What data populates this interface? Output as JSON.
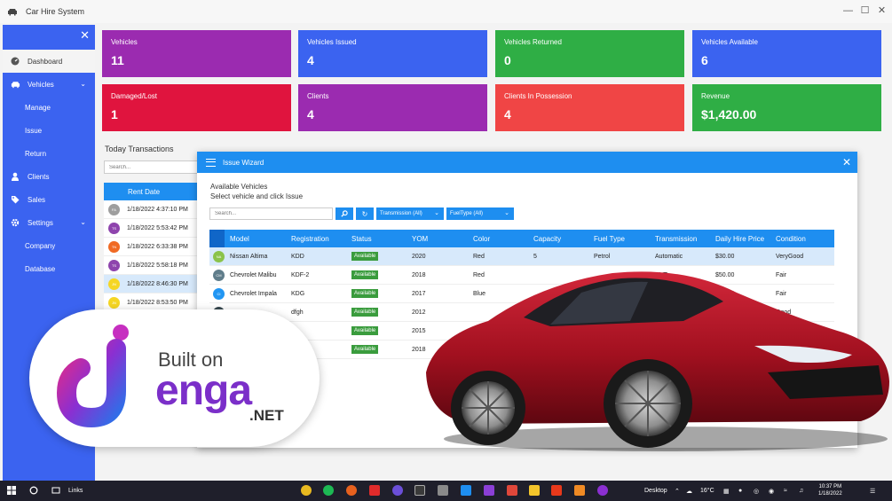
{
  "window": {
    "title": "Car Hire System"
  },
  "sidebar": {
    "items": [
      {
        "label": "Dashboard",
        "icon": "gauge-icon",
        "type": "main"
      },
      {
        "label": "Vehicles",
        "icon": "car-icon",
        "type": "main",
        "expanded": true
      },
      {
        "label": "Manage",
        "type": "sub"
      },
      {
        "label": "Issue",
        "type": "sub"
      },
      {
        "label": "Return",
        "type": "sub"
      },
      {
        "label": "Clients",
        "icon": "user-icon",
        "type": "main"
      },
      {
        "label": "Sales",
        "icon": "tag-icon",
        "type": "main"
      },
      {
        "label": "Settings",
        "icon": "gear-icon",
        "type": "main",
        "expanded": true
      },
      {
        "label": "Company",
        "type": "sub"
      },
      {
        "label": "Database",
        "type": "sub"
      }
    ]
  },
  "cards": [
    {
      "label": "Vehicles",
      "value": "11",
      "color": "#9b2bb0"
    },
    {
      "label": "Vehicles Issued",
      "value": "4",
      "color": "#3b63f0"
    },
    {
      "label": "Vehicles Returned",
      "value": "0",
      "color": "#2fae45"
    },
    {
      "label": "Vehicles Available",
      "value": "6",
      "color": "#3b63f0"
    },
    {
      "label": "Damaged/Lost",
      "value": "1",
      "color": "#e0143e"
    },
    {
      "label": "Clients",
      "value": "4",
      "color": "#9b2bb0"
    },
    {
      "label": "Clients In Possession",
      "value": "4",
      "color": "#f04545"
    },
    {
      "label": "Revenue",
      "value": "$1,420.00",
      "color": "#2fae45"
    }
  ],
  "transactions": {
    "title": "Today Transactions",
    "search_placeholder": "Search...",
    "header": "Rent Date",
    "rows": [
      {
        "initials": "FA",
        "color": "#9e9e9e",
        "date": "1/18/2022 4:37:10 PM"
      },
      {
        "initials": "TS",
        "color": "#8e44ad",
        "date": "1/18/2022 5:53:42 PM"
      },
      {
        "initials": "TN",
        "color": "#f06a24",
        "date": "1/18/2022 6:33:38 PM"
      },
      {
        "initials": "TS",
        "color": "#8e44ad",
        "date": "1/18/2022 5:58:18 PM"
      },
      {
        "initials": "JN",
        "color": "#f5d623",
        "date": "1/18/2022 8:46:30 PM",
        "selected": true
      },
      {
        "initials": "JN",
        "color": "#f5d623",
        "date": "1/18/2022 8:53:50 PM"
      }
    ]
  },
  "wizard": {
    "title": "Issue Wizard",
    "heading1": "Available Vehicles",
    "heading2": "Select vehicle and click Issue",
    "search_placeholder": "Search...",
    "transmission_filter": "Transmission (All)",
    "fueltype_filter": "FuelType (All)",
    "columns": [
      "Model",
      "Registration",
      "Status",
      "YOM",
      "Color",
      "Capacity",
      "Fuel Type",
      "Transmission",
      "Daily Hire Price",
      "Condition"
    ],
    "rows": [
      {
        "initials": "NA",
        "color": "#8bc34a",
        "model": "Nissan Altima",
        "registration": "KDD",
        "status": "Available",
        "yom": "2020",
        "color_name": "Red",
        "capacity": "5",
        "fuel": "Petrol",
        "transmission": "Automatic",
        "price": "$30.00",
        "condition": "VeryGood",
        "selected": true
      },
      {
        "initials": "CM",
        "color": "#607d8b",
        "model": "Chevrolet Malibu",
        "registration": "KDF-2",
        "status": "Available",
        "yom": "2018",
        "color_name": "Red",
        "capacity": "",
        "fuel": "",
        "transmission": "CVT",
        "price": "$50.00",
        "condition": "Fair"
      },
      {
        "initials": "CI",
        "color": "#2196f3",
        "model": "Chevrolet Impala",
        "registration": "KDG",
        "status": "Available",
        "yom": "2017",
        "color_name": "Blue",
        "capacity": "",
        "fuel": "",
        "transmission": "",
        "price": "$45.00",
        "condition": "Fair"
      },
      {
        "initials": "",
        "color": "#37474f",
        "model": "",
        "registration": "dfgh",
        "status": "Available",
        "yom": "2012",
        "color_name": "",
        "capacity": "",
        "fuel": "",
        "transmission": "",
        "price": "",
        "condition": "Good"
      },
      {
        "initials": "",
        "color": "#cccccc",
        "model": "",
        "registration": "",
        "status": "Available",
        "yom": "2015",
        "color_name": "",
        "capacity": "",
        "fuel": "",
        "transmission": "",
        "price": "",
        "condition": ""
      },
      {
        "initials": "",
        "color": "#cccccc",
        "model": "",
        "registration": "",
        "status": "Available",
        "yom": "2018",
        "color_name": "",
        "capacity": "",
        "fuel": "",
        "transmission": "",
        "price": "",
        "condition": ""
      }
    ]
  },
  "promo": {
    "built_on": "Built on",
    "word": "enga",
    "net": ".NET"
  },
  "taskbar": {
    "links": "Links",
    "desktop": "Desktop",
    "temperature": "16°C",
    "time": "10:37 PM",
    "date": "1/18/2022"
  }
}
